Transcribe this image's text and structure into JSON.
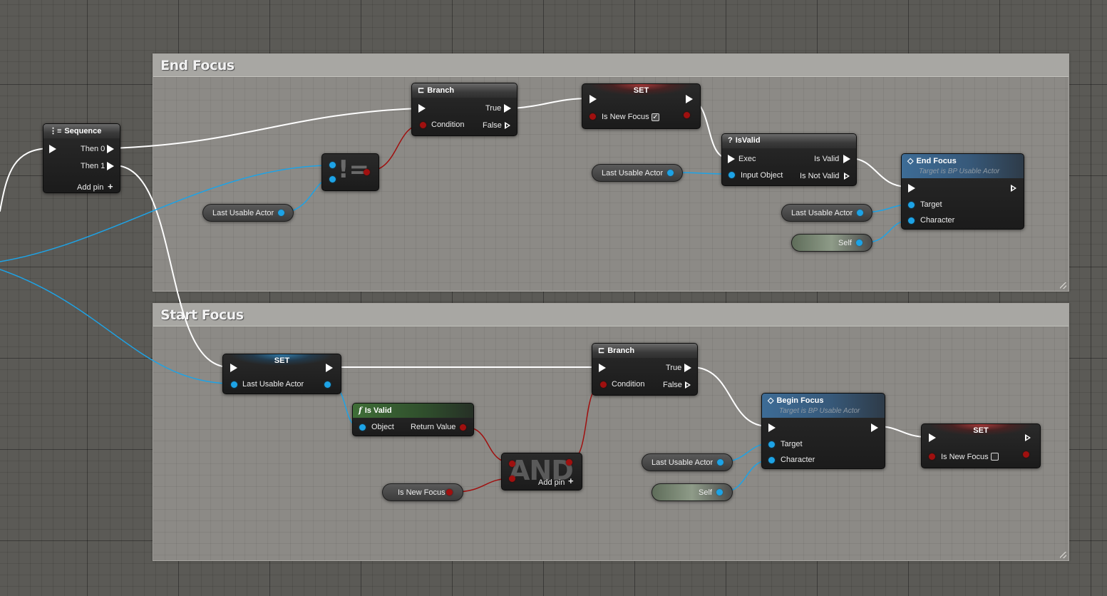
{
  "comments": {
    "end_focus": "End Focus",
    "start_focus": "Start Focus"
  },
  "sequence": {
    "title": "Sequence",
    "then0": "Then 0",
    "then1": "Then 1",
    "add_pin": "Add pin"
  },
  "end_focus_section": {
    "branch": {
      "title": "Branch",
      "true": "True",
      "false": "False",
      "condition": "Condition"
    },
    "not_equal": {
      "symbol": "!="
    },
    "last_usable_actor_pill": "Last Usable Actor",
    "set": {
      "title": "SET",
      "variable": "Is New Focus",
      "checked": "✓"
    },
    "is_valid_macro": {
      "title": "IsValid",
      "icon": "?",
      "exec": "Exec",
      "input_object": "Input Object",
      "is_valid": "Is Valid",
      "is_not_valid": "Is Not Valid"
    },
    "last_usable_actor_pill_2": "Last Usable Actor",
    "end_focus_call": {
      "title": "End Focus",
      "subtitle": "Target is BP Usable Actor",
      "target": "Target",
      "character": "Character"
    },
    "last_usable_actor_pill_3": "Last Usable Actor",
    "self_pill": "Self"
  },
  "start_focus_section": {
    "set": {
      "title": "SET",
      "variable": "Last Usable Actor"
    },
    "is_valid_func": {
      "title": "Is Valid",
      "icon": "f",
      "object": "Object",
      "return_value": "Return Value"
    },
    "is_new_focus_pill": "Is New Focus",
    "and_node": {
      "symbol": "AND",
      "add_pin": "Add pin"
    },
    "branch": {
      "title": "Branch",
      "true": "True",
      "false": "False",
      "condition": "Condition"
    },
    "begin_focus_call": {
      "title": "Begin Focus",
      "subtitle": "Target is BP Usable Actor",
      "target": "Target",
      "character": "Character"
    },
    "last_usable_actor_pill": "Last Usable Actor",
    "self_pill": "Self",
    "set2": {
      "title": "SET",
      "variable": "Is New Focus"
    }
  },
  "colors": {
    "exec_wire": "#ffffff",
    "object_pin": "#1da3e6",
    "bool_pin": "#a0100f",
    "graph_bg": "#5b5a56",
    "comment_bg": "#8c8a86"
  },
  "icons": {
    "sequence": "sequence-icon",
    "branch": "branch-icon",
    "function": "function-icon",
    "event": "diamond-icon",
    "macro": "question-icon"
  }
}
